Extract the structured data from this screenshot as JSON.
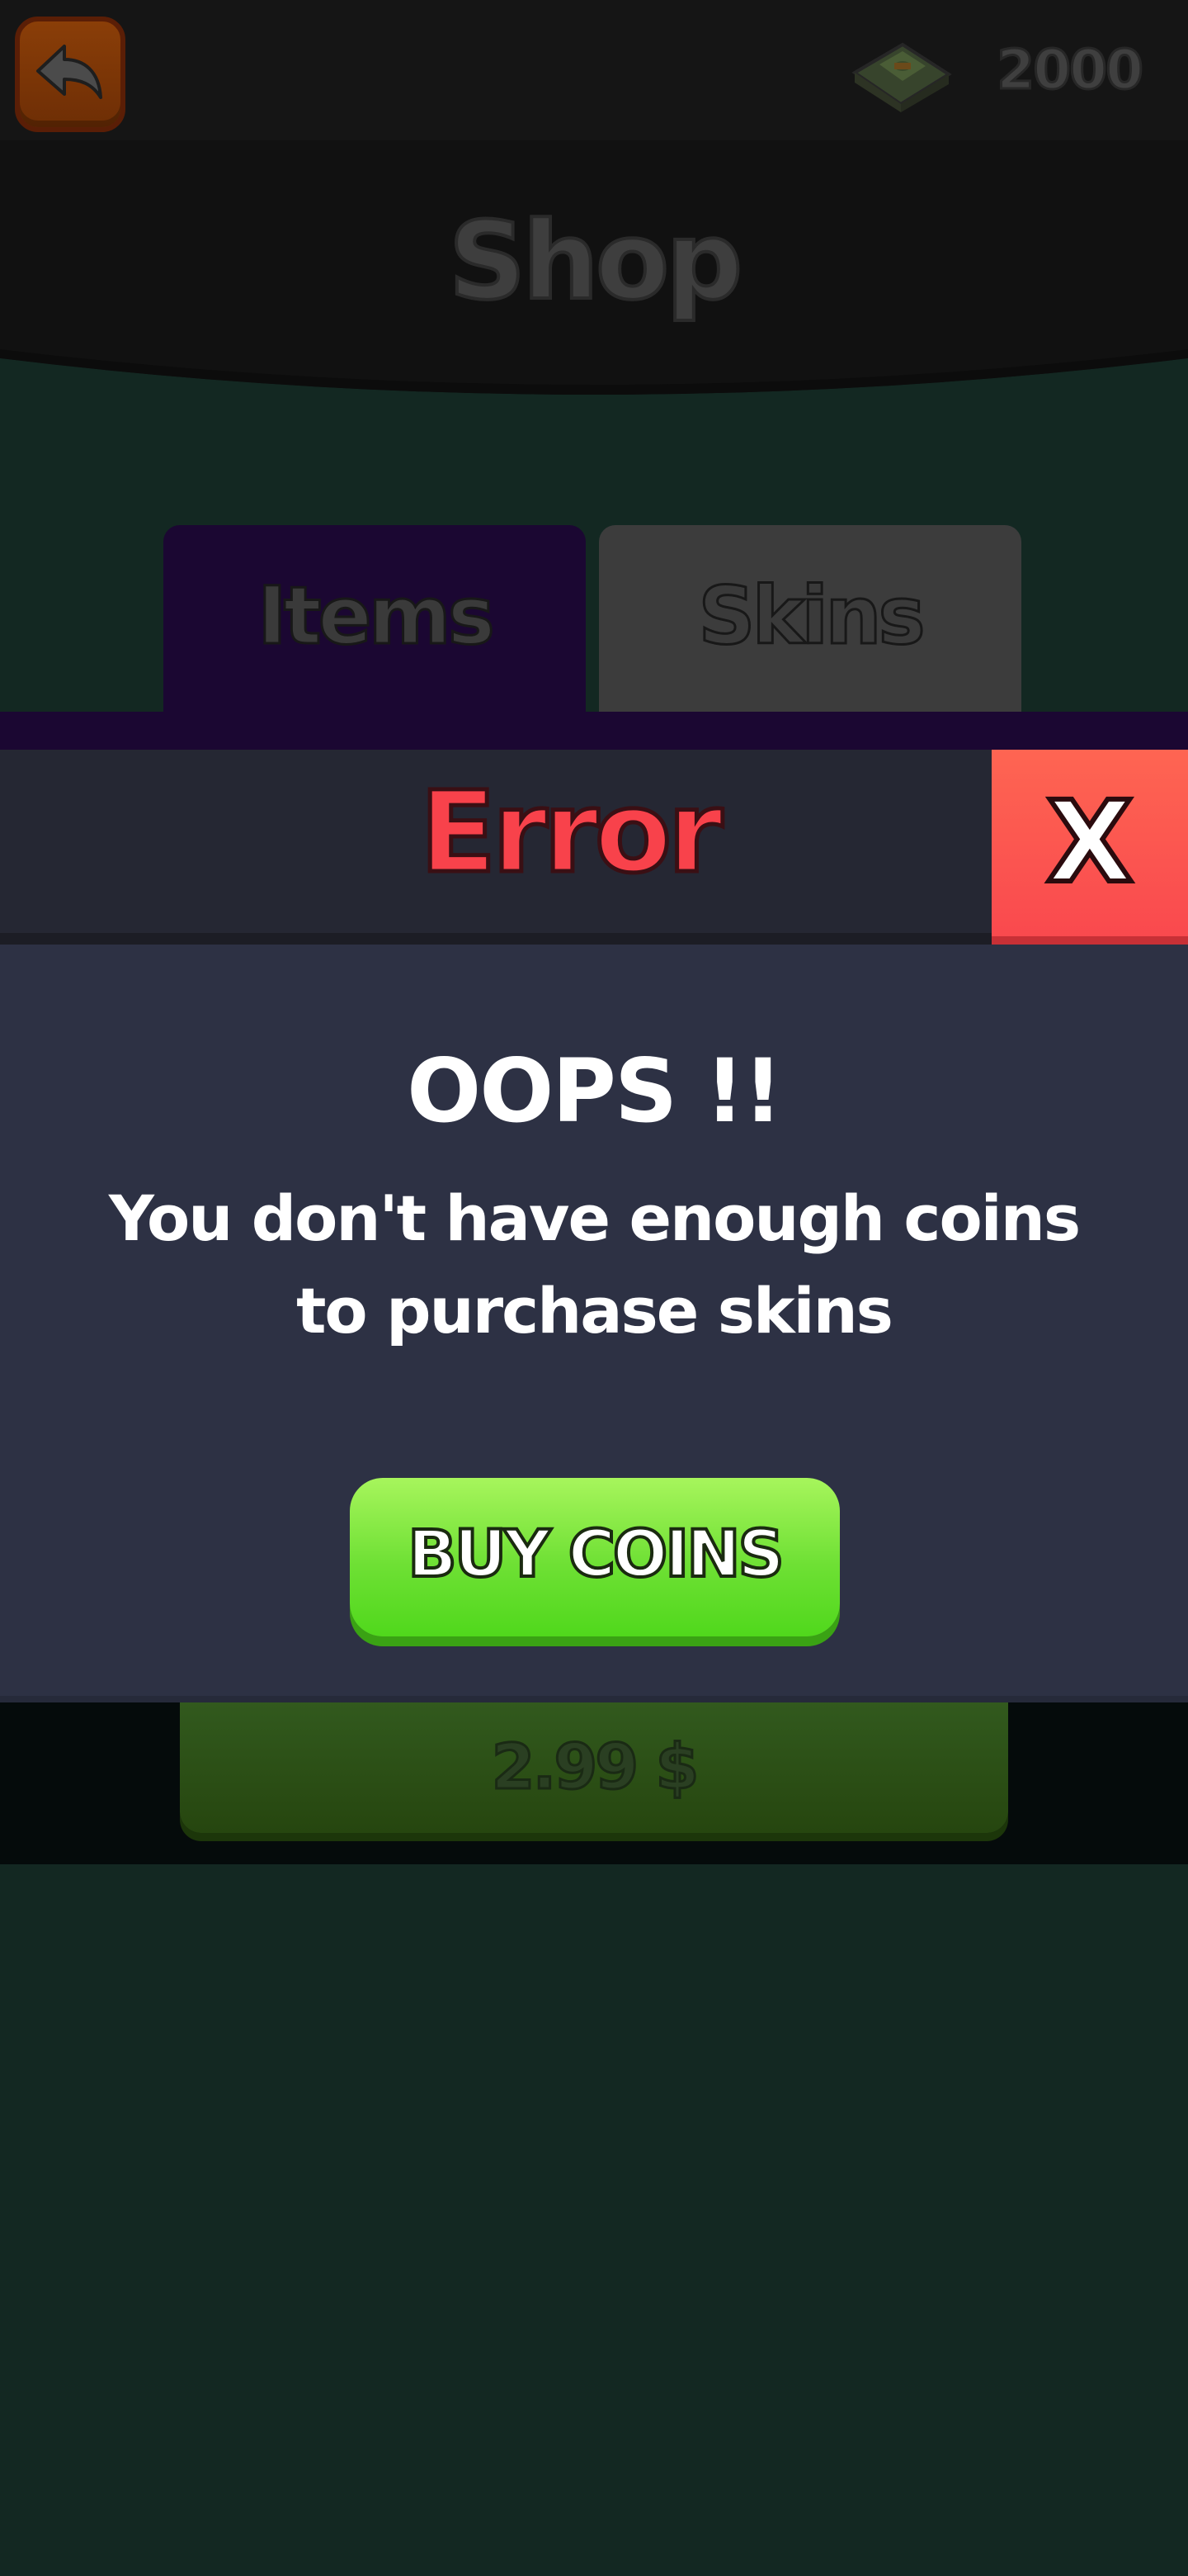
{
  "header": {
    "back_button_icon": "back-arrow-icon",
    "cash_icon": "cash-stack-icon",
    "coins": "2000",
    "title": "Shop"
  },
  "tabs": [
    {
      "label": "Items",
      "selected": true
    },
    {
      "label": "Skins",
      "selected": false
    }
  ],
  "purchase": {
    "price_label": "2.99 $"
  },
  "error_modal": {
    "title": "Error",
    "close_label": "X",
    "heading": "OOPS !!",
    "message": "You don't have enough coins to purchase skins",
    "buy_coins_label": "BUY COINS"
  },
  "colors": {
    "background": "#132822",
    "items_tab": "#1b0732",
    "error_title": "#f8424b",
    "close_button": "#f9484e",
    "buy_button": "#6ee034",
    "modal_body": "#2d3144"
  }
}
